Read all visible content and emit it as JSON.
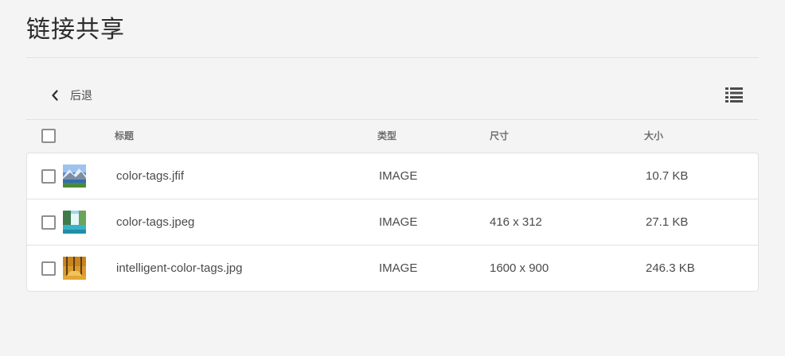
{
  "page": {
    "title": "链接共享"
  },
  "toolbar": {
    "back_label": "后退"
  },
  "table": {
    "headers": {
      "title": "标题",
      "type": "类型",
      "size": "尺寸",
      "filesize": "大小"
    },
    "rows": [
      {
        "name": "color-tags.jfif",
        "type": "IMAGE",
        "dimensions": "",
        "filesize": "10.7 KB",
        "thumbnail": "mountain-lake-thumbnail"
      },
      {
        "name": "color-tags.jpeg",
        "type": "IMAGE",
        "dimensions": "416 x 312",
        "filesize": "27.1 KB",
        "thumbnail": "waterfall-thumbnail"
      },
      {
        "name": "intelligent-color-tags.jpg",
        "type": "IMAGE",
        "dimensions": "1600 x 900",
        "filesize": "246.3 KB",
        "thumbnail": "autumn-forest-thumbnail"
      }
    ]
  },
  "icons": {
    "back": "chevron-left-icon",
    "view": "list-view-icon"
  },
  "colors": {
    "background": "#f4f4f4",
    "row_bg": "#ffffff",
    "border": "#e1e1e1",
    "text": "#4b4b4b"
  }
}
